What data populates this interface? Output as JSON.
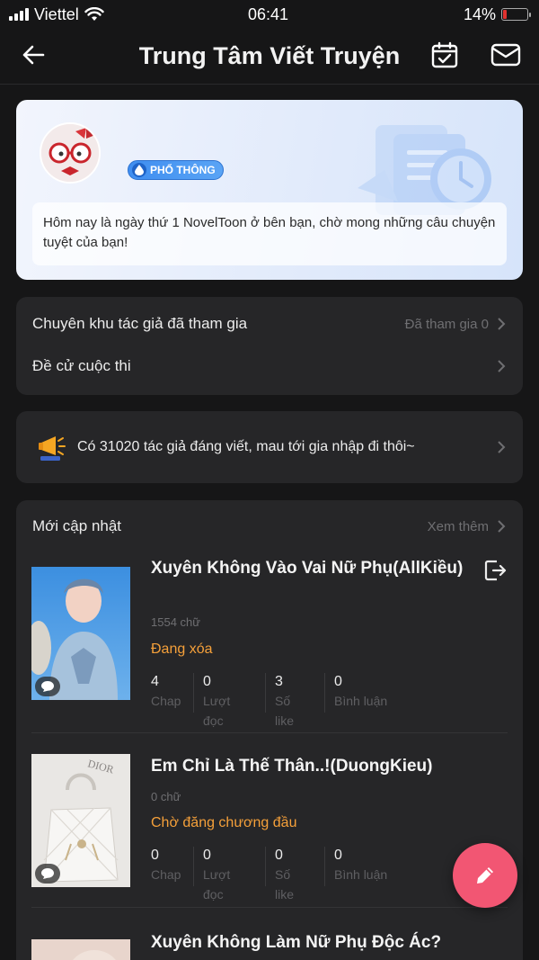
{
  "status_bar": {
    "carrier": "Viettel",
    "time": "06:41",
    "battery": "14%",
    "battery_level": 0.14
  },
  "header": {
    "title": "Trung Tâm Viết Truyện",
    "back_icon": "arrow-left-icon",
    "calendar_icon": "calendar-check-icon",
    "mail_icon": "mail-icon"
  },
  "profile": {
    "level": "PHỔ THÔNG",
    "greeting": "Hôm nay là ngày thứ 1 NovelToon ở bên bạn, chờ mong những câu chuyện tuyệt của bạn!"
  },
  "menu": {
    "items": [
      {
        "label": "Chuyên khu tác giả đã tham gia",
        "meta": "Đã tham gia 0"
      },
      {
        "label": "Đề cử cuộc thi",
        "meta": ""
      }
    ]
  },
  "notice": {
    "text": "Có 31020 tác giả đáng viết, mau tới gia nhập đi thôi~",
    "icon": "megaphone-icon"
  },
  "recent": {
    "title": "Mới cập nhật",
    "more": "Xem thêm",
    "stories": [
      {
        "title": "Xuyên Không Vào Vai Nữ Phụ(AllKiều)",
        "words": "1554 chữ",
        "status": "Đang xóa",
        "stats": [
          {
            "num": "4",
            "label": "Chap"
          },
          {
            "num": "0",
            "label": "Lượt đọc"
          },
          {
            "num": "3",
            "label": "Số like"
          },
          {
            "num": "0",
            "label": "Bình luận"
          }
        ]
      },
      {
        "title": "Em Chỉ Là Thế Thân..!(DuongKieu)",
        "words": "0 chữ",
        "status": "Chờ đăng chương đầu",
        "stats": [
          {
            "num": "0",
            "label": "Chap"
          },
          {
            "num": "0",
            "label": "Lượt đọc"
          },
          {
            "num": "0",
            "label": "Số like"
          },
          {
            "num": "0",
            "label": "Bình luận"
          }
        ]
      },
      {
        "title": "Xuyên Không Làm Nữ Phụ Độc Ác?"
      }
    ]
  },
  "colors": {
    "accent_status": "#f5a03a",
    "fab": "#f25673",
    "background": "#161617",
    "card": "#262628"
  }
}
